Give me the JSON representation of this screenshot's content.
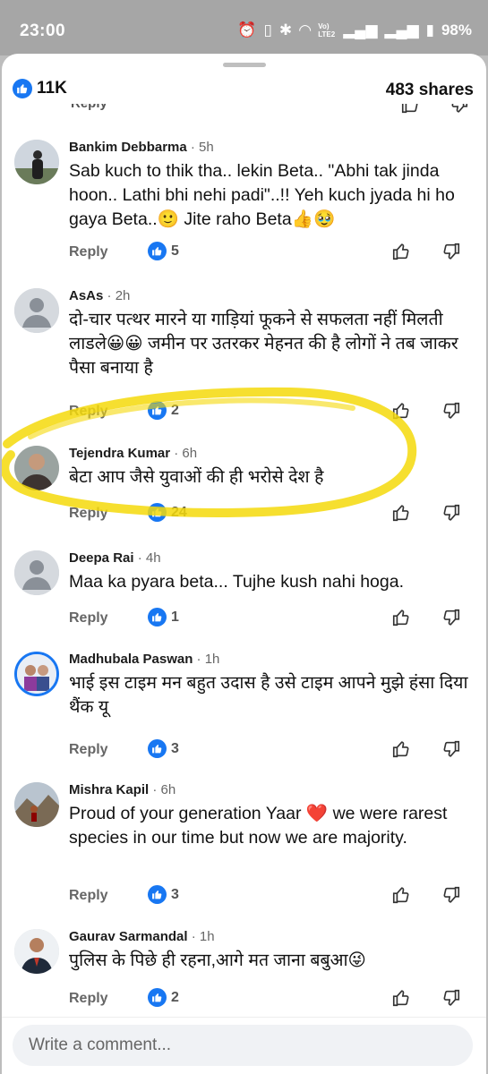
{
  "status": {
    "time": "23:00",
    "battery": "98%",
    "lte": "Vo) LTE2"
  },
  "header": {
    "likes": "11K",
    "shares": "483 shares"
  },
  "partial_row": {
    "reply": "Reply"
  },
  "comments": [
    {
      "author": "Bankim Debbarma",
      "time": " · 5h",
      "text": "Sab kuch to thik tha.. lekin Beta..  \"Abhi tak jinda hoon.. Lathi bhi nehi padi\"..!! Yeh kuch jyada hi ho gaya Beta..🙂 Jite raho Beta👍🥹",
      "reply": "Reply",
      "reactions": "5"
    },
    {
      "author": "AsAs",
      "time": " · 2h",
      "text": "दो-चार पत्थर मारने या गाड़ियां फूकने से सफलता नहीं मिलती लाडले😀😀 जमीन पर उतरकर मेहनत की है लोगों ने तब जाकर पैसा बनाया है",
      "reply": "Reply",
      "reactions": "2"
    },
    {
      "author": "Tejendra Kumar",
      "time": " · 6h",
      "text": "बेटा आप जैसे युवाओं की ही भरोसे देश है",
      "reply": "Reply",
      "reactions": "24"
    },
    {
      "author": "Deepa Rai",
      "time": " · 4h",
      "text": "Maa ka pyara beta... Tujhe kush nahi hoga.",
      "reply": "Reply",
      "reactions": "1"
    },
    {
      "author": "Madhubala Paswan",
      "time": " · 1h",
      "text": "भाई इस टाइम मन बहुत उदास है उसे टाइम आपने मुझे हंसा दिया थैंक यू",
      "reply": "Reply",
      "reactions": "3"
    },
    {
      "author": "Mishra Kapil",
      "time": " · 6h",
      "text": "Proud of your generation Yaar ❤️ we were rarest species in our time but now we are majority.",
      "reply": "Reply",
      "reactions": "3"
    },
    {
      "author": "Gaurav Sarmandal",
      "time": " · 1h",
      "text": "पुलिस के पिछे ही रहना,आगे मत जाना बबुआ😜",
      "reply": "Reply",
      "reactions": "2"
    }
  ],
  "composer": {
    "placeholder": "Write a comment..."
  },
  "colors": {
    "accent": "#1877f2",
    "highlight": "#f5d90a"
  },
  "icons": [
    "like-icon",
    "thumbs-up-icon",
    "thumbs-down-icon",
    "default-avatar-icon"
  ]
}
